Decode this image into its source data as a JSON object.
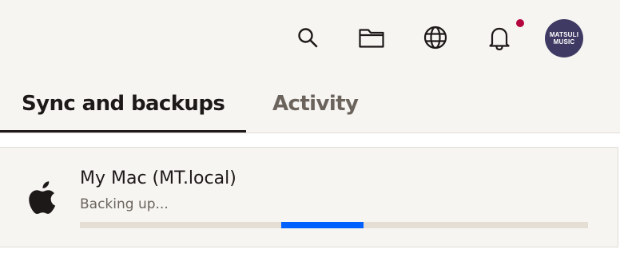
{
  "header": {
    "icons": [
      "search-icon",
      "folder-icon",
      "globe-icon",
      "bell-icon"
    ],
    "notification_dot_color": "#b4053f",
    "avatar": {
      "line1": "MATSULI",
      "line2": "MUSIC",
      "color": "#3f3a63"
    }
  },
  "tabs": [
    {
      "label": "Sync and backups",
      "active": true
    },
    {
      "label": "Activity",
      "active": false
    }
  ],
  "device": {
    "icon": "apple-icon",
    "name": "My Mac (MT.local)",
    "status": "Backing up...",
    "progress": {
      "indeterminate": true,
      "segment_start": 0.397,
      "segment_end": 0.558,
      "color": "#0061fe"
    }
  }
}
